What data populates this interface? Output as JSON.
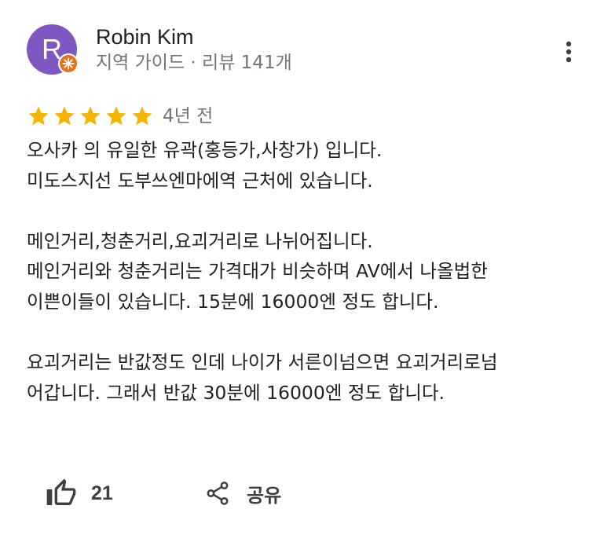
{
  "author": {
    "initial": "R",
    "name": "Robin Kim",
    "meta": "지역 가이드 · 리뷰 141개",
    "avatar_color": "#7e57c2",
    "badge_color": "#e8711c"
  },
  "review": {
    "rating": 5,
    "rating_max": 5,
    "star_color": "#f4b400",
    "date": "4년 전",
    "text_lines": [
      "오사카 의 유일한 유곽(홍등가,사창가) 입니다.",
      "미도스지선 도부쓰엔마에역 근처에 있습니다.",
      "",
      "메인거리,청춘거리,요괴거리로 나뉘어집니다.",
      "메인거리와 청춘거리는 가격대가 비슷하며 AV에서 나올법한",
      "이쁜이들이 있습니다. 15분에 16000엔 정도 합니다.",
      "",
      "요괴거리는 반값정도 인데 나이가 서른이넘으면 요괴거리로넘",
      "어갑니다. 그래서 반값 30분에 16000엔 정도 합니다."
    ]
  },
  "actions": {
    "like_icon": "thumb-up-outline",
    "like_count": "21",
    "share_icon": "share",
    "share_label": "공유",
    "more_icon": "more-vert"
  }
}
